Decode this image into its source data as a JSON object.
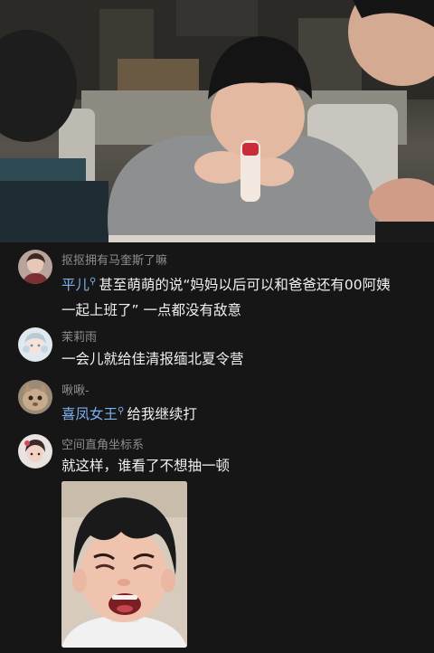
{
  "comments": [
    {
      "username": "抠抠拥有马奎斯了嘛",
      "mention": "平儿",
      "text": "甚至萌萌的说“妈妈以后可以和爸爸还有00阿姨",
      "text_line2": "一起上班了” 一点都没有敌意"
    },
    {
      "username": "茉莉雨",
      "text": "一会儿就给佳清报缅北夏令营"
    },
    {
      "username": "啾啾-",
      "mention": "喜凤女王",
      "text": "给我继续打"
    },
    {
      "username": "空间直角坐标系",
      "text": "就这样，谁看了不想抽一顿"
    }
  ],
  "colors": {
    "background": "#161616",
    "username": "#8e8e8e",
    "body_text": "#f0f0f0",
    "mention": "#7fb0ee"
  },
  "icons": {
    "mention_marker": "user-mention-icon"
  }
}
